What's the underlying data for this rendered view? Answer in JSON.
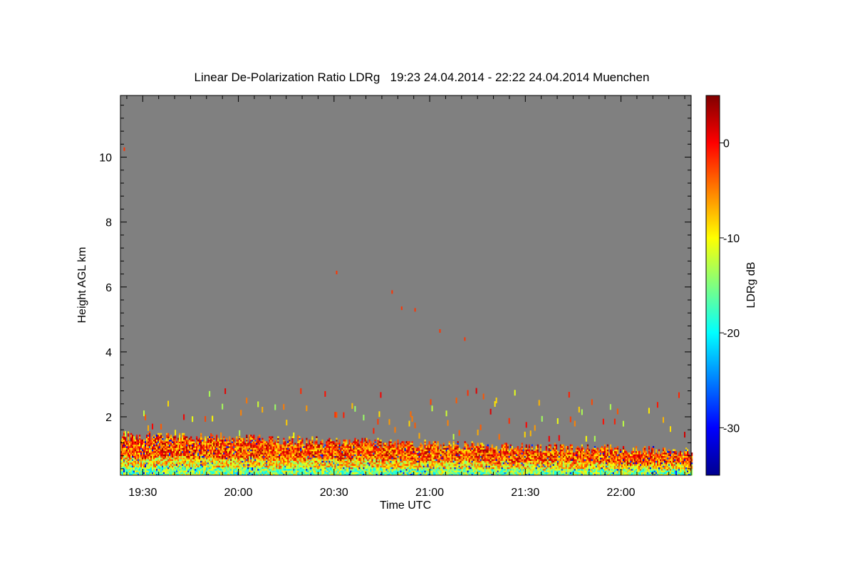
{
  "chart_data": {
    "type": "heatmap",
    "title": "Linear De-Polarization Ratio LDRg   19:23 24.04.2014 - 22:22 24.04.2014 Muenchen",
    "xlabel": "Time UTC",
    "ylabel": "Height AGL km",
    "colorbar_label": "LDRg dB",
    "x_range": [
      "19:23",
      "22:22"
    ],
    "x_ticks": [
      "19:30",
      "20:00",
      "20:30",
      "21:00",
      "21:30",
      "22:00"
    ],
    "ylim": [
      0.2,
      11.9
    ],
    "y_ticks": [
      2,
      4,
      6,
      8,
      10
    ],
    "y_tick_labels": [
      "2",
      "4",
      "6",
      "8",
      "10"
    ],
    "clim": [
      -35,
      5
    ],
    "colorbar_ticks": [
      0,
      -10,
      -20,
      -30
    ],
    "colorbar_tick_labels": [
      "0",
      "-10",
      "-20",
      "-30"
    ],
    "colormap": "jet",
    "background_color": "#808080",
    "boundary_layer_top_km": 1.4,
    "grid": false
  }
}
